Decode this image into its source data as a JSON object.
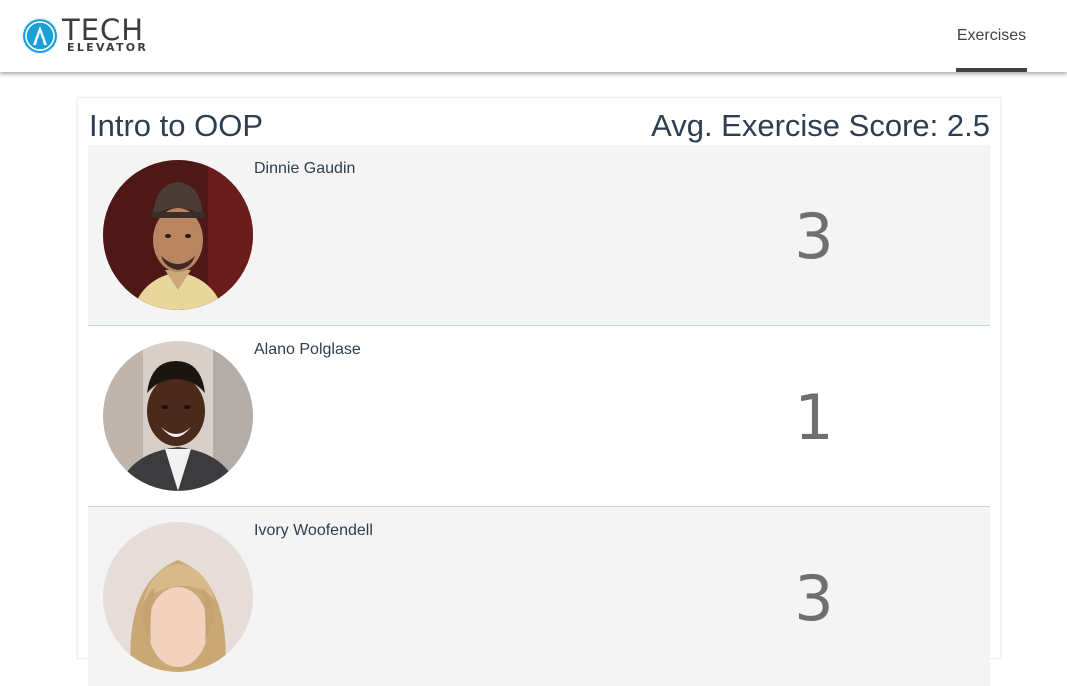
{
  "header": {
    "logo": {
      "main_text": "TECH",
      "sub_text": "ELEVATOR",
      "icon": "tech-elevator-logo-icon",
      "color": "#1aa1d8"
    },
    "nav": [
      {
        "label": "Exercises",
        "active": true
      }
    ]
  },
  "course": {
    "title": "Intro to OOP",
    "avg_label": "Avg. Exercise Score:",
    "avg_value": "2.5"
  },
  "students": [
    {
      "name": "Dinnie Gaudin",
      "score": "3",
      "avatar_icon": "student-photo-icon"
    },
    {
      "name": "Alano Polglase",
      "score": "1",
      "avatar_icon": "student-photo-icon"
    },
    {
      "name": "Ivory Woofendell",
      "score": "3",
      "avatar_icon": "student-photo-icon"
    }
  ],
  "colors": {
    "row_shade": "#f4f4f4",
    "divider": "#b4dde6",
    "text": "#2c3e50",
    "score": "#6f6f6f",
    "nav_underline": "#424242"
  }
}
